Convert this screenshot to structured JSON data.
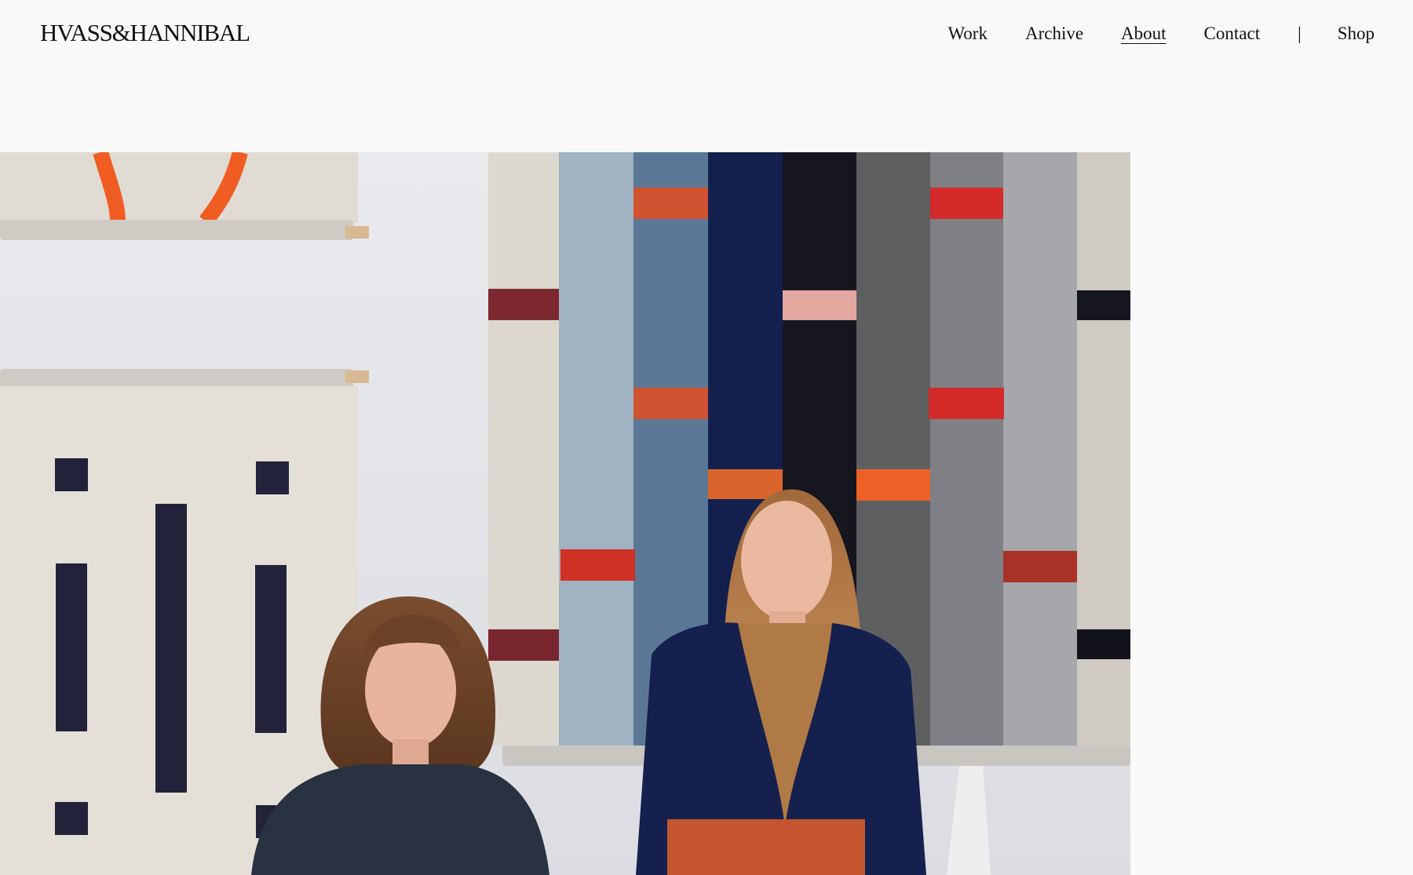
{
  "header": {
    "logo": "HVASS&HANNIBAL",
    "nav": [
      {
        "label": "Work",
        "active": false
      },
      {
        "label": "Archive",
        "active": false
      },
      {
        "label": "About",
        "active": true
      },
      {
        "label": "Contact",
        "active": false
      }
    ],
    "separator": "|",
    "shop_label": "Shop"
  },
  "hero": {
    "colors": {
      "page_bg": "#faf9fa",
      "wall": "#e7e8ec",
      "linen": "#ddd8d0",
      "orange": "#f05d23",
      "navy": "#131e4a",
      "terracotta": "#c95a36"
    }
  }
}
